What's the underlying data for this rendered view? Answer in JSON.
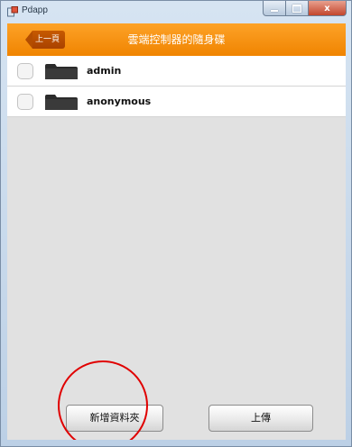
{
  "window": {
    "title": "Pdapp",
    "minimize_icon": "minimize-icon",
    "maximize_icon": "maximize-icon",
    "close_label": "x"
  },
  "header": {
    "back_label": "上一頁",
    "title": "雲端控制器的隨身碟"
  },
  "list": {
    "items": [
      {
        "label": "admin",
        "icon": "folder-icon",
        "checked": false
      },
      {
        "label": "anonymous",
        "icon": "folder-icon",
        "checked": false
      }
    ]
  },
  "footer": {
    "new_folder_label": "新增資料夾",
    "upload_label": "上傳"
  },
  "colors": {
    "accent": "#f08400",
    "annotation": "#e00000"
  }
}
